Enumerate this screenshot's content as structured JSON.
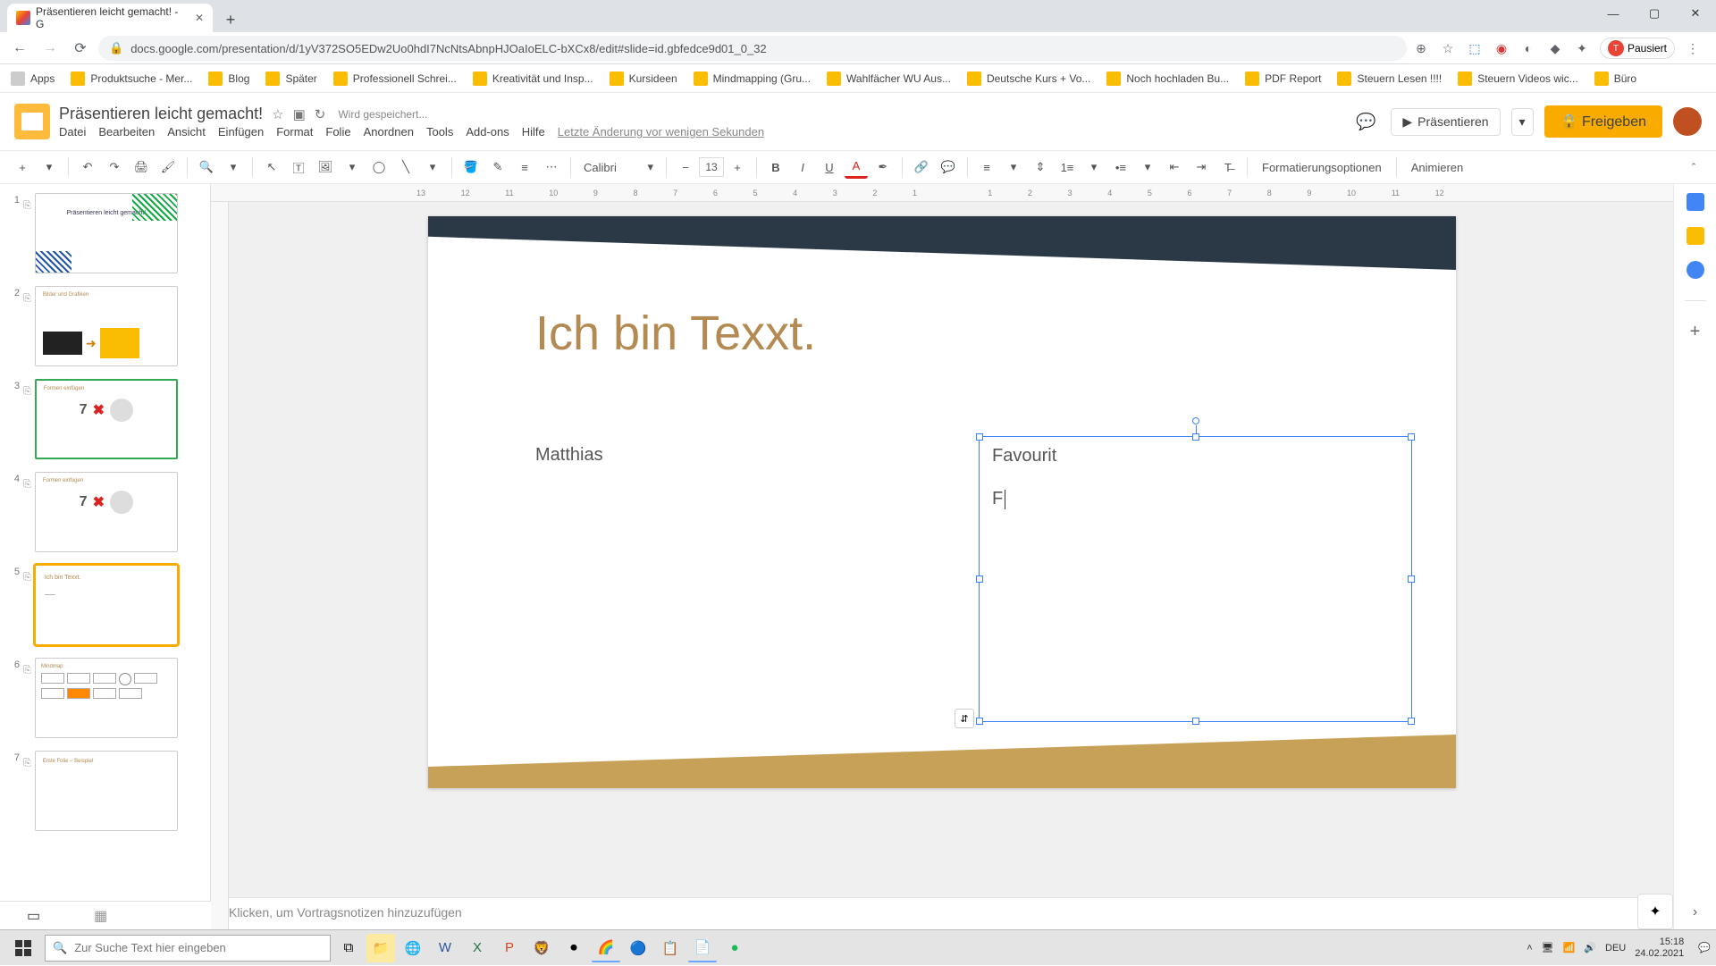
{
  "browser": {
    "tab_title": "Präsentieren leicht gemacht! - G",
    "url": "docs.google.com/presentation/d/1yV372SO5EDw2Uo0hdI7NcNtsAbnpHJOaIoELC-bXCx8/edit#slide=id.gbfedce9d01_0_32",
    "paused_label": "Pausiert"
  },
  "bookmarks": [
    "Apps",
    "Produktsuche - Mer...",
    "Blog",
    "Später",
    "Professionell Schrei...",
    "Kreativität und Insp...",
    "Kursideen",
    "Mindmapping (Gru...",
    "Wahlfächer WU Aus...",
    "Deutsche Kurs + Vo...",
    "Noch hochladen Bu...",
    "PDF Report",
    "Steuern Lesen !!!!",
    "Steuern Videos wic...",
    "Büro"
  ],
  "doc": {
    "title": "Präsentieren leicht gemacht!",
    "saving": "Wird gespeichert...",
    "menus": [
      "Datei",
      "Bearbeiten",
      "Ansicht",
      "Einfügen",
      "Format",
      "Folie",
      "Anordnen",
      "Tools",
      "Add-ons",
      "Hilfe"
    ],
    "last_edit": "Letzte Änderung vor wenigen Sekunden",
    "present": "Präsentieren",
    "share": "Freigeben"
  },
  "toolbar": {
    "font": "Calibri",
    "font_size": "13",
    "format_options": "Formatierungsoptionen",
    "animate": "Animieren"
  },
  "ruler_h": [
    "13",
    "12",
    "11",
    "10",
    "9",
    "8",
    "7",
    "6",
    "5",
    "4",
    "3",
    "2",
    "1",
    "",
    "1",
    "2",
    "3",
    "4",
    "5",
    "6",
    "7",
    "8",
    "9",
    "10",
    "11",
    "12"
  ],
  "slides": [
    {
      "n": "1",
      "label": "Präsentieren leicht gemacht!"
    },
    {
      "n": "2",
      "label": "Bilder und Grafiken"
    },
    {
      "n": "3",
      "label": "Formen einfügen"
    },
    {
      "n": "4",
      "label": "Formen einfügen"
    },
    {
      "n": "5",
      "label": "Ich bin Texxt."
    },
    {
      "n": "6",
      "label": "Mindmap"
    },
    {
      "n": "7",
      "label": "Erste Folie – Beispiel"
    }
  ],
  "canvas": {
    "title": "Ich bin Texxt.",
    "left_text": "Matthias",
    "tb_line1": "Favourit",
    "tb_line2": "F"
  },
  "notes_placeholder": "Klicken, um Vortragsnotizen hinzuzufügen",
  "taskbar": {
    "search_placeholder": "Zur Suche Text hier eingeben",
    "lang": "DEU",
    "time": "15:18",
    "date": "24.02.2021"
  }
}
